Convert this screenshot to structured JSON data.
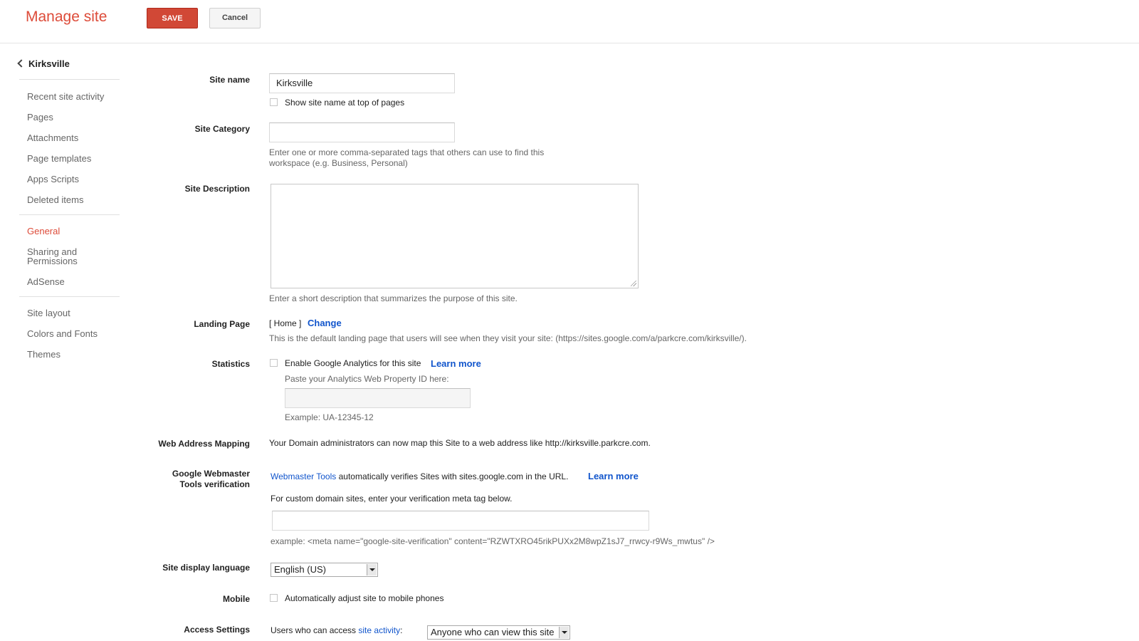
{
  "header": {
    "title": "Manage site",
    "save_label": "SAVE",
    "cancel_label": "Cancel"
  },
  "sidebar": {
    "back_label": "Kirksville",
    "groups": [
      [
        "Recent site activity",
        "Pages",
        "Attachments",
        "Page templates",
        "Apps Scripts",
        "Deleted items"
      ],
      [
        "General",
        "Sharing and Permissions",
        "AdSense"
      ],
      [
        "Site layout",
        "Colors and Fonts",
        "Themes"
      ]
    ],
    "items": {
      "recent": "Recent site activity",
      "pages": "Pages",
      "attachments": "Attachments",
      "templates": "Page templates",
      "scripts": "Apps Scripts",
      "deleted": "Deleted items",
      "general": "General",
      "sharing_1": "Sharing and",
      "sharing_2": "Permissions",
      "adsense": "AdSense",
      "layout": "Site layout",
      "colors": "Colors and Fonts",
      "themes": "Themes"
    },
    "active_item": "General"
  },
  "form": {
    "site_name": {
      "label": "Site name",
      "value": "Kirksville",
      "checkbox_label": "Show site name at top of pages",
      "checked": false
    },
    "site_category": {
      "label": "Site Category",
      "value": "",
      "help_1": "Enter one or more comma-separated tags that others can use to find this",
      "help_2": "workspace (e.g. Business, Personal)"
    },
    "site_description": {
      "label": "Site Description",
      "value": "",
      "help": "Enter a short description that summarizes the purpose of this site."
    },
    "landing_page": {
      "label": "Landing Page",
      "value": "[ Home ]",
      "change_label": "Change",
      "help": "This is the default landing page that users will see when they visit your site: (https://sites.google.com/a/parkcre.com/kirksville/)."
    },
    "statistics": {
      "label": "Statistics",
      "checkbox_label": "Enable Google Analytics for this site",
      "learn_more": "Learn more",
      "paste_label": "Paste your Analytics Web Property ID here:",
      "value": "",
      "example": "Example: UA-12345-12"
    },
    "web_address": {
      "label": "Web Address Mapping",
      "text": "Your Domain administrators can now map this Site to a web address like http://kirksville.parkcre.com."
    },
    "webmaster": {
      "label_1": "Google Webmaster",
      "label_2": "Tools verification",
      "tools_link": "Webmaster Tools",
      "text": " automatically verifies Sites with sites.google.com in the URL.",
      "learn_more": "Learn more",
      "custom_text": "For custom domain sites, enter your verification meta tag below.",
      "value": "",
      "example": "example: <meta name=\"google-site-verification\" content=\"RZWTXRO45rikPUXx2M8wpZ1sJ7_rrwcy-r9Ws_mwtus\" />"
    },
    "language": {
      "label": "Site display language",
      "value": "English (US)"
    },
    "mobile": {
      "label": "Mobile",
      "checkbox_label": "Automatically adjust site to mobile phones"
    },
    "access": {
      "label": "Access Settings",
      "text": "Users who can access ",
      "link": "site activity",
      "colon": ":",
      "value": "Anyone who can view this site"
    }
  }
}
